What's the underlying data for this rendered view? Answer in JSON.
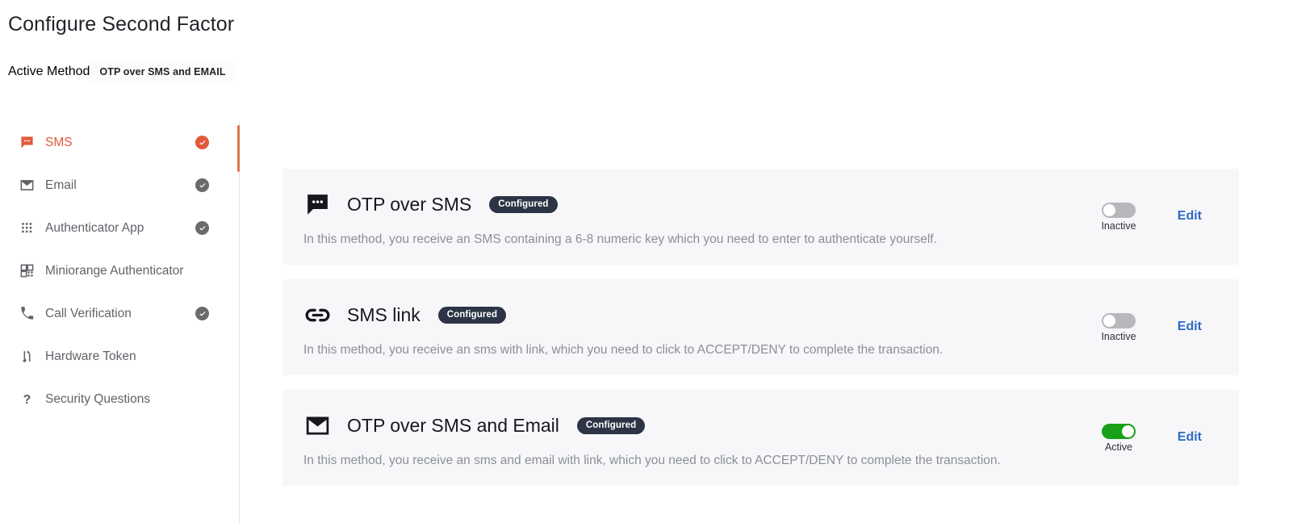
{
  "header": {
    "title": "Configure Second Factor",
    "active_method_label": "Active Method",
    "active_method_value": "OTP over SMS and EMAIL"
  },
  "sidebar": {
    "items": [
      {
        "label": "SMS",
        "icon": "chat-bubble-icon",
        "configured": true,
        "selected": true
      },
      {
        "label": "Email",
        "icon": "envelope-icon",
        "configured": true,
        "selected": false
      },
      {
        "label": "Authenticator App",
        "icon": "grid-dots-icon",
        "configured": true,
        "selected": false
      },
      {
        "label": "Miniorange Authenticator",
        "icon": "qr-code-icon",
        "configured": false,
        "selected": false
      },
      {
        "label": "Call Verification",
        "icon": "phone-icon",
        "configured": true,
        "selected": false
      },
      {
        "label": "Hardware Token",
        "icon": "usb-token-icon",
        "configured": false,
        "selected": false
      },
      {
        "label": "Security Questions",
        "icon": "question-mark-icon",
        "configured": false,
        "selected": false
      }
    ]
  },
  "methods": [
    {
      "title": "OTP over SMS",
      "icon": "chat-bubble-icon",
      "badge": "Configured",
      "description": "In this method, you receive an SMS containing a 6-8 numeric key which you need to enter to authenticate yourself.",
      "toggle_state": "Inactive",
      "toggle_on": false,
      "edit_label": "Edit"
    },
    {
      "title": "SMS link",
      "icon": "link-icon",
      "badge": "Configured",
      "description": "In this method, you receive an sms with link, which you need to click to ACCEPT/DENY to complete the transaction.",
      "toggle_state": "Inactive",
      "toggle_on": false,
      "edit_label": "Edit"
    },
    {
      "title": "OTP over SMS and Email",
      "icon": "envelope-icon",
      "badge": "Configured",
      "description": "In this method, you receive an sms and email with link, which you need to click to ACCEPT/DENY to complete the transaction.",
      "toggle_state": "Active",
      "toggle_on": true,
      "edit_label": "Edit"
    }
  ],
  "colors": {
    "accent_orange": "#e2593a",
    "active_green": "#17a018",
    "edit_blue": "#2f6bc4",
    "badge_navy": "#2c3445",
    "card_bg": "#f7f7f9"
  }
}
